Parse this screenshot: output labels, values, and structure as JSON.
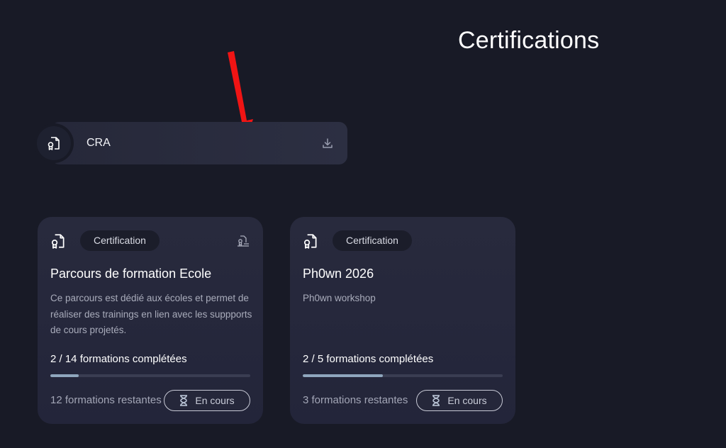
{
  "page": {
    "title": "Certifications"
  },
  "certificate": {
    "label": "CRA",
    "icon": "certificate-file-icon",
    "action_icon": "download-icon"
  },
  "cards": [
    {
      "tag": "Certification",
      "icon": "certificate-file-icon",
      "corner_icon": "certificate-group-icon",
      "title": "Parcours de formation Ecole",
      "description": "Ce parcours est dédié aux écoles et permet de réaliser des trainings en lien avec les suppports de cours projetés.",
      "progress_label": "2 / 14 formations complétées",
      "progress_fraction": 0.143,
      "remaining": "12 formations restantes",
      "status": "En cours",
      "status_icon": "hourglass-icon"
    },
    {
      "tag": "Certification",
      "icon": "certificate-file-icon",
      "title": "Ph0wn 2026",
      "description": "Ph0wn workshop",
      "progress_label": "2 / 5 formations complétées",
      "progress_fraction": 0.4,
      "remaining": "3 formations restantes",
      "status": "En cours",
      "status_icon": "hourglass-icon"
    }
  ],
  "colors": {
    "background": "#181a26",
    "card": "#282a3d",
    "progress": "#8fa6bd",
    "annotation_arrow": "#f01414"
  }
}
